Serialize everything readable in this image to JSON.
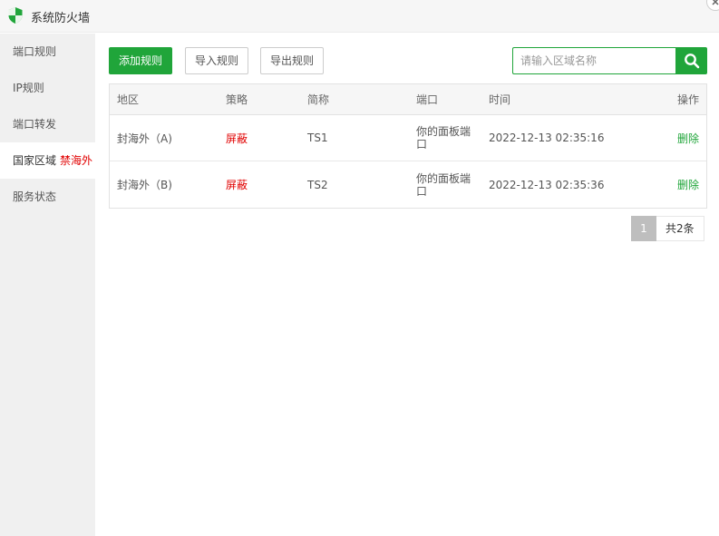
{
  "window": {
    "title": "系统防火墙"
  },
  "sidebar": {
    "items": [
      {
        "label": "端口规则"
      },
      {
        "label": "IP规则"
      },
      {
        "label": "端口转发"
      },
      {
        "label": "国家区域",
        "badge": "禁海外",
        "active": true
      },
      {
        "label": "服务状态"
      }
    ]
  },
  "toolbar": {
    "add_label": "添加规则",
    "import_label": "导入规则",
    "export_label": "导出规则",
    "search_placeholder": "请输入区域名称"
  },
  "table": {
    "headers": {
      "region": "地区",
      "strategy": "策略",
      "short": "简称",
      "port": "端口",
      "time": "时间",
      "op": "操作"
    },
    "rows": [
      {
        "region": "封海外（A)",
        "strategy": "屏蔽",
        "short": "TS1",
        "port": "你的面板端口",
        "time": "2022-12-13 02:35:16",
        "op": "删除"
      },
      {
        "region": "封海外（B)",
        "strategy": "屏蔽",
        "short": "TS2",
        "port": "你的面板端口",
        "time": "2022-12-13 02:35:36",
        "op": "删除"
      }
    ]
  },
  "pagination": {
    "current": "1",
    "total": "共2条"
  },
  "colors": {
    "accent": "#20a53a",
    "danger": "#e10000"
  }
}
